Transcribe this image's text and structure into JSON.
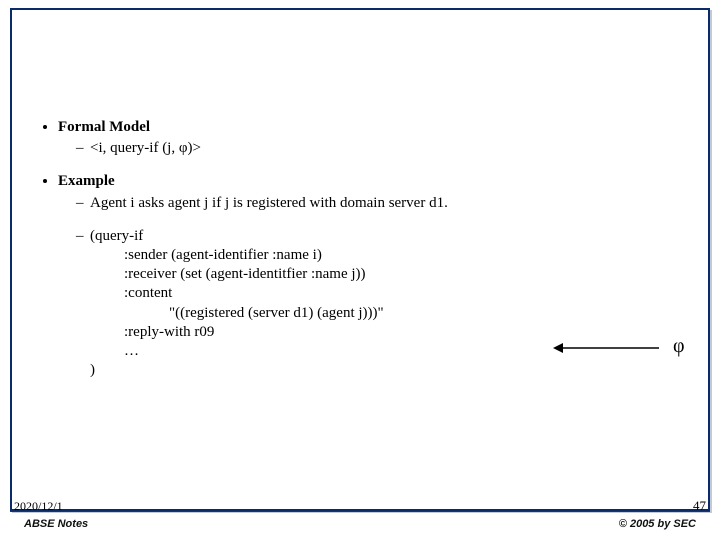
{
  "sections": {
    "formal_model": {
      "heading": "Formal Model",
      "item": "<i, query-if (j, φ)>"
    },
    "example": {
      "heading": "Example",
      "description": "Agent i asks agent j if j is registered with domain server d1.",
      "code": {
        "open": "(query-if",
        "lines": [
          ":sender (agent-identifier :name i)",
          ":receiver (set (agent-identitfier :name j))",
          ":content",
          "            \"((registered (server d1) (agent j)))\"",
          ":reply-with r09",
          "…"
        ],
        "close": ")"
      }
    }
  },
  "annotation": {
    "phi": "φ"
  },
  "footer": {
    "date": "2020/12/1",
    "page": "47",
    "left": "ABSE Notes",
    "right": "© 2005 by SEC"
  }
}
